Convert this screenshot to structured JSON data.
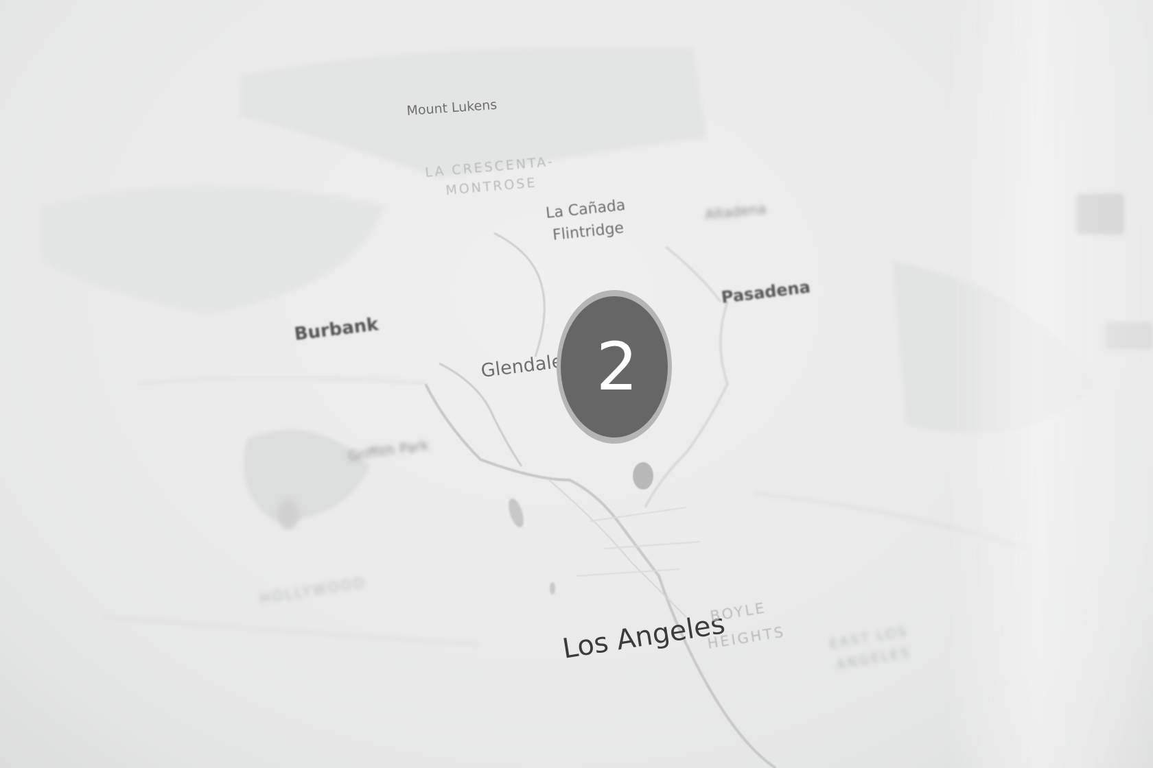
{
  "map": {
    "places": {
      "mount_lukens": "Mount Lukens",
      "la_crescenta_line1": "LA CRESCENTA-",
      "la_crescenta_line2": "MONTROSE",
      "la_canada_line1": "La Cañada",
      "la_canada_line2": "Flintridge",
      "altadena": "Altadena",
      "pasadena": "Pasadena",
      "burbank": "Burbank",
      "glendale": "Glendale",
      "los_angeles": "Los Angeles",
      "boyle_line1": "BOYLE",
      "boyle_line2": "HEIGHTS",
      "east_la_line1": "EAST LOS",
      "east_la_line2": "ANGELES",
      "hollywood": "HOLLYWOOD",
      "griffith_park": "Griffith Park"
    },
    "cluster": {
      "count": "2",
      "fill_color": "#666666",
      "ring_color": "#b5b5b5"
    },
    "marker": {
      "color": "#b9b9b9"
    },
    "colors": {
      "background": "#ebebeb",
      "road": "#d2d2d2",
      "water": "#c4c4c4"
    }
  }
}
